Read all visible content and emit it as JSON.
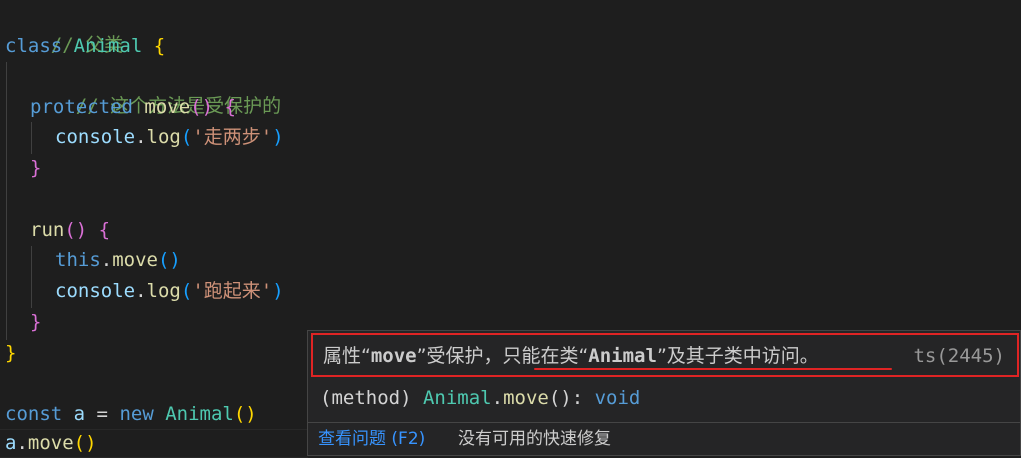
{
  "code": {
    "l1": {
      "comment": "// 父类"
    },
    "l2": {
      "kw": "class",
      "name": "Animal",
      "brace": "{"
    },
    "l3": {
      "comment": "// 这个方法是受保护的"
    },
    "l4": {
      "kw": "protected",
      "fn": "move",
      "parens": "()",
      "brace": "{"
    },
    "l5": {
      "obj": "console",
      "dot": ".",
      "fn": "log",
      "open": "(",
      "str": "'走两步'",
      "close": ")"
    },
    "l6": {
      "brace": "}"
    },
    "l8": {
      "fn": "run",
      "parens": "()",
      "brace": "{"
    },
    "l9": {
      "kw": "this",
      "dot": ".",
      "fn": "move",
      "parens": "()"
    },
    "l10": {
      "obj": "console",
      "dot": ".",
      "fn": "log",
      "open": "(",
      "str": "'跑起来'",
      "close": ")"
    },
    "l11": {
      "brace": "}"
    },
    "l12": {
      "brace": "}"
    },
    "l14": {
      "kw": "const",
      "var": "a",
      "eq": " = ",
      "new": "new",
      "cls": "Animal",
      "parens": "()"
    },
    "l15": {
      "var": "a",
      "dot": ".",
      "fn": "move",
      "parens": "()"
    }
  },
  "hover": {
    "diag_pre": "属性“",
    "diag_prop": "move",
    "diag_mid": "”受保护，只能在类“",
    "diag_cls": "Animal",
    "diag_post": "”及其子类中访问。",
    "diag_code": "ts(2445)",
    "sig_kind": "(method)",
    "sig_cls": "Animal",
    "sig_dot": ".",
    "sig_fn": "move",
    "sig_rest": "(): ",
    "sig_type": "void",
    "link": "查看问题 (F2)",
    "nofix": "没有可用的快速修复"
  },
  "colors": {
    "background": "#1e1e1e",
    "error_box": "#e02424",
    "link": "#3794ff"
  }
}
